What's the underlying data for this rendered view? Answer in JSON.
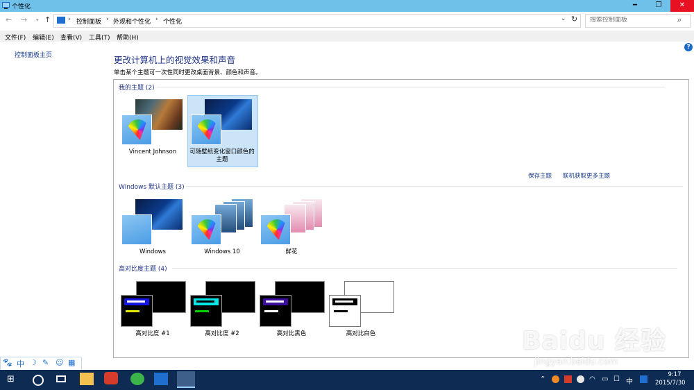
{
  "window": {
    "title": "个性化"
  },
  "nav": {
    "crumbs": [
      "控制面板",
      "外观和个性化",
      "个性化"
    ],
    "search_placeholder": "搜索控制面板"
  },
  "menu": [
    "文件(F)",
    "编辑(E)",
    "查看(V)",
    "工具(T)",
    "帮助(H)"
  ],
  "sidebar": {
    "home_link": "控制面板主页"
  },
  "main": {
    "title": "更改计算机上的视觉效果和声音",
    "subtitle": "单击某个主题可一次性同时更改桌面背景、颜色和声音。",
    "help": "?"
  },
  "groups": {
    "my": {
      "header": "我的主题 (2)",
      "themes": [
        "Vincent Johnson",
        "可随壁纸变化窗口颜色的主题"
      ]
    },
    "links": {
      "save": "保存主题",
      "more": "联机获取更多主题"
    },
    "windows": {
      "header": "Windows 默认主题 (3)",
      "themes": [
        "Windows",
        "Windows 10",
        "鲜花"
      ]
    },
    "contrast": {
      "header": "高对比度主题 (4)",
      "themes": [
        "高对比度 #1",
        "高对比度 #2",
        "高对比黑色",
        "高对比白色"
      ]
    }
  },
  "selected_theme": "可随壁纸变化窗口颜色的主题",
  "ime": {
    "mode": "中"
  },
  "taskbar": {
    "time": "9:17",
    "date": "2015/7/30",
    "ime_tray": "中"
  },
  "watermark": {
    "main": "Baidu 经验",
    "sub": "jingyan.baidu.com"
  },
  "colors": {
    "titlebar": "#6fc1ea",
    "taskbar": "#0d2b53",
    "link": "#1a3d8c",
    "heading": "#1e3287",
    "close": "#e81123",
    "selection": "#cce4f7"
  }
}
